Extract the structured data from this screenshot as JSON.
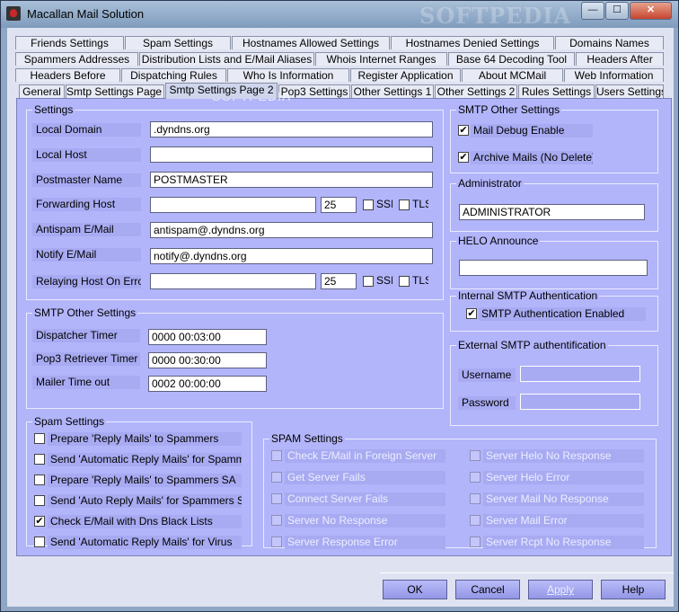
{
  "window": {
    "title": "Macallan Mail Solution",
    "watermark": "SOFTPEDIA",
    "minimize": "—",
    "maximize": "☐",
    "close": "✕"
  },
  "tabs": {
    "row1": [
      "Friends Settings",
      "Spam Settings",
      "Hostnames Allowed Settings",
      "Hostnames Denied Settings",
      "Domains Names"
    ],
    "row2": [
      "Spammers Addresses",
      "Distribution Lists and E/Mail Aliases",
      "Whois Internet Ranges",
      "Base 64 Decoding Tool",
      "Headers After"
    ],
    "row3": [
      "Headers Before",
      "Dispatching Rules",
      "Who Is Information",
      "Register Application",
      "About MCMail",
      "Web Information"
    ],
    "row4": [
      "General",
      "Smtp Settings Page 1",
      "Smtp Settings Page 2",
      "Pop3 Settings",
      "Other Settings 1",
      "Other Settings 2",
      "Rules Settings",
      "Users Settings"
    ]
  },
  "settings": {
    "title": "Settings",
    "local_domain_label": "Local Domain",
    "local_domain_value": ".dyndns.org",
    "local_host_label": "Local Host",
    "local_host_value": "",
    "postmaster_label": "Postmaster Name",
    "postmaster_value": "POSTMASTER",
    "forwarding_label": "Forwarding Host",
    "forwarding_value": "",
    "forwarding_port": "25",
    "ssl_label": "SSI",
    "tls_label": "TLS",
    "antispam_label": "Antispam E/Mail",
    "antispam_value": "antispam@.dyndns.org",
    "notify_label": "Notify E/Mail",
    "notify_value": "notify@.dyndns.org",
    "relaying_label": "Relaying Host On Error",
    "relaying_value": "",
    "relaying_port": "25"
  },
  "smtp_other_right": {
    "title": "SMTP Other Settings",
    "mail_debug": "Mail Debug Enable",
    "archive": "Archive Mails (No Delete)"
  },
  "administrator": {
    "title": "Administrator",
    "value": "ADMINISTRATOR"
  },
  "helo": {
    "title": "HELO Announce",
    "value": ""
  },
  "internal_auth": {
    "title": "Internal SMTP Authentication",
    "enabled_label": "SMTP Authentication Enabled"
  },
  "external_auth": {
    "title": "External SMTP authentification",
    "username_label": "Username",
    "password_label": "Password"
  },
  "smtp_other_left": {
    "title": "SMTP Other Settings",
    "dispatcher_label": "Dispatcher Timer",
    "dispatcher_value": "0000 00:03:00",
    "pop3_label": "Pop3 Retriever Timer",
    "pop3_value": "0000 00:30:00",
    "mailer_label": "Mailer Time out",
    "mailer_value": "0002 00:00:00"
  },
  "spam_left": {
    "title": "Spam Settings",
    "items": [
      "Prepare 'Reply Mails' to Spammers",
      "Send 'Automatic Reply Mails' for Spammers",
      "Prepare 'Reply Mails' to Spammers SA",
      "Send 'Auto Reply Mails' for Spammers SA",
      "Check E/Mail with Dns Black Lists",
      "Send 'Automatic Reply Mails' for Virus"
    ],
    "checked": [
      false,
      false,
      false,
      false,
      true,
      false
    ]
  },
  "spam_right": {
    "title": "SPAM Settings",
    "col1": [
      "Check E/Mail in Foreign Server",
      "Get Server Fails",
      "Connect Server Fails",
      "Server No Response",
      "Server Response Error"
    ],
    "col2": [
      "Server Helo No Response",
      "Server Helo Error",
      "Server Mail No Response",
      "Server Mail Error",
      "Server Rcpt No Response"
    ]
  },
  "buttons": {
    "ok": "OK",
    "cancel": "Cancel",
    "apply": "Apply",
    "help": "Help"
  }
}
